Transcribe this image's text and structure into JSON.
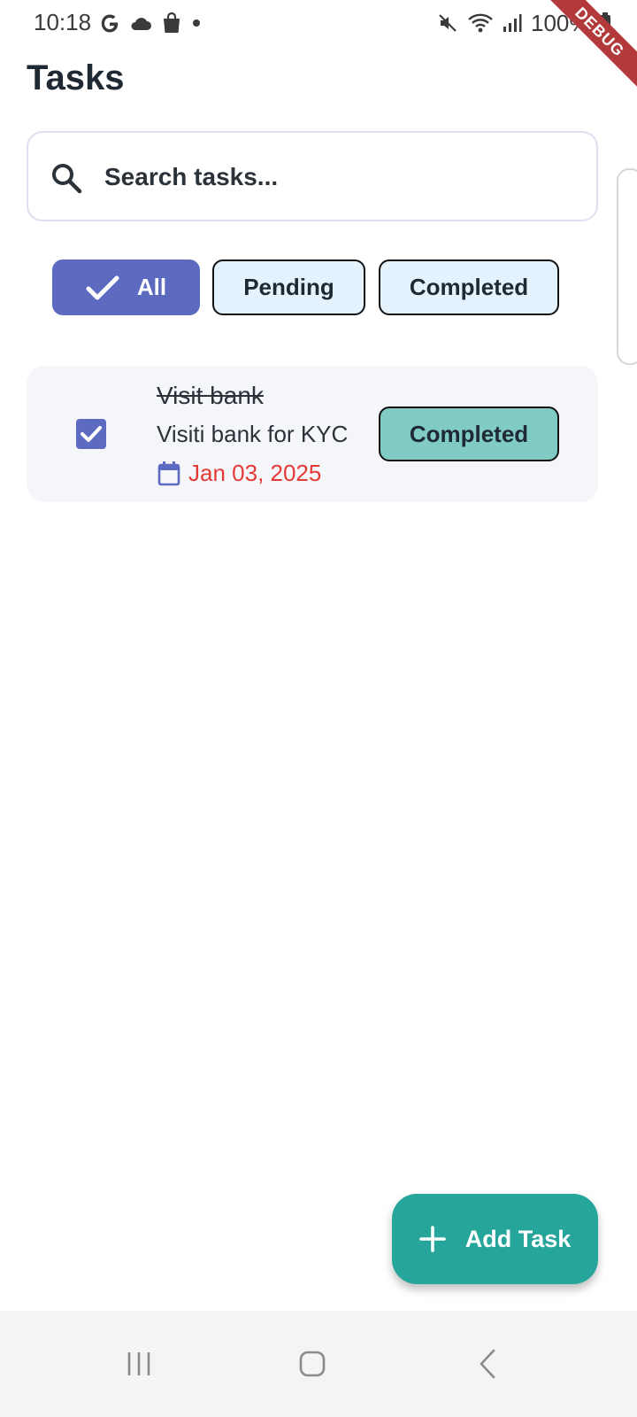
{
  "status_bar": {
    "time": "10:18",
    "battery": "100%",
    "debug_label": "DEBUG"
  },
  "page": {
    "title": "Tasks"
  },
  "search": {
    "placeholder": "Search tasks..."
  },
  "filters": {
    "all": "All",
    "pending": "Pending",
    "completed": "Completed",
    "selected": "All"
  },
  "tasks": [
    {
      "title": "Visit bank",
      "description": "Visiti bank for KYC",
      "due_date": "Jan 03, 2025",
      "checked": true,
      "status": "Completed"
    }
  ],
  "fab": {
    "label": "Add Task"
  },
  "colors": {
    "accent": "#5c6bc0",
    "teal": "#26a69a",
    "status_completed_bg": "#80cbc4",
    "chip_bg": "#e3f2fd",
    "overdue_date": "#e53935"
  },
  "icons": {
    "search": "search-icon",
    "check": "check-icon",
    "calendar": "calendar-icon",
    "add": "plus-icon",
    "nav_recents": "recents-icon",
    "nav_home": "home-icon",
    "nav_back": "back-icon"
  }
}
